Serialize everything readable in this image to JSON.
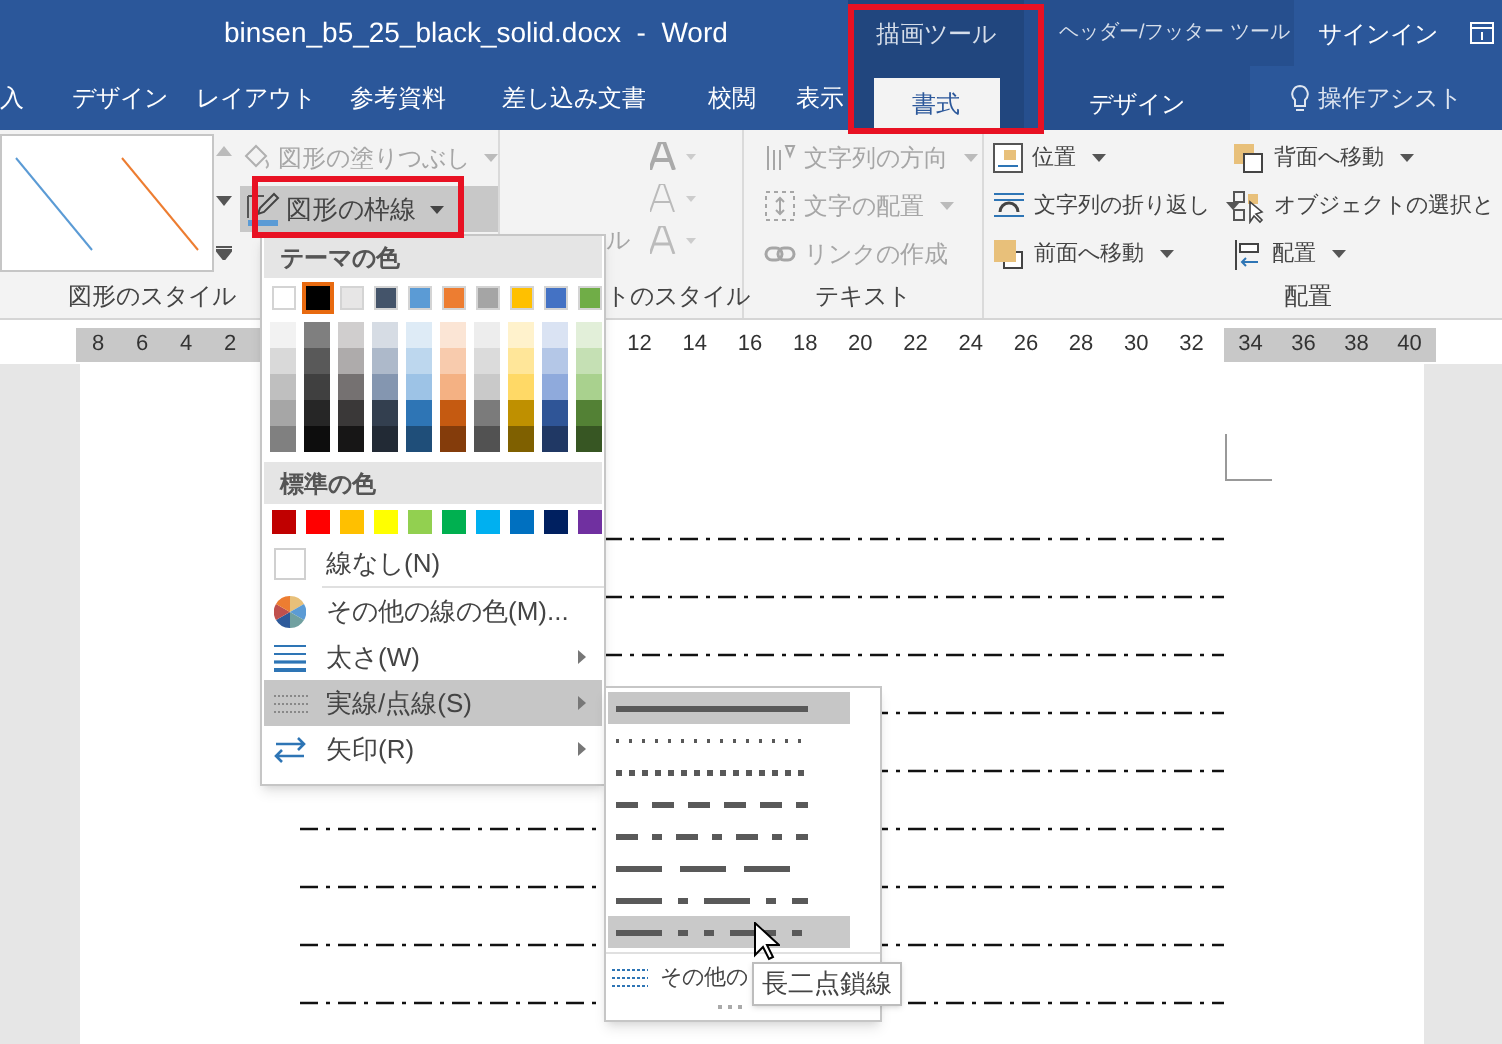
{
  "window": {
    "title": "binsen_b5_25_black_solid.docx  -  Word",
    "context_groups": [
      {
        "label": "描画ツール"
      },
      {
        "label": "ヘッダー/フッター ツール"
      }
    ],
    "sign_in": "サインイン"
  },
  "tabs": [
    {
      "label": "入",
      "selected": false
    },
    {
      "label": "デザイン",
      "selected": false
    },
    {
      "label": "レイアウト",
      "selected": false
    },
    {
      "label": "参考資料",
      "selected": false
    },
    {
      "label": "差し込み文書",
      "selected": false
    },
    {
      "label": "校閲",
      "selected": false
    },
    {
      "label": "表示",
      "selected": false
    }
  ],
  "context_tabs": [
    {
      "label": "書式",
      "selected": true
    },
    {
      "label": "デザイン",
      "selected": false
    }
  ],
  "tell_me": "操作アシスト",
  "shape_styles": {
    "fill_button": {
      "label": "図形の塗りつぶし",
      "disabled": true
    },
    "outline_button": {
      "label": "図形の枠線",
      "pressed": true
    },
    "group_label": "図形のスタイル"
  },
  "wordart_styles": {
    "quick_style_fragment": "ル",
    "group_label": "トのスタイル"
  },
  "text_group": {
    "commands": [
      {
        "kind": "direction",
        "label": "文字列の方向",
        "disabled": true
      },
      {
        "kind": "align",
        "label": "文字の配置",
        "disabled": true
      },
      {
        "kind": "link",
        "label": "リンクの作成",
        "disabled": true
      }
    ],
    "group_label": "テキスト"
  },
  "arrange": {
    "commands": [
      {
        "kind": "position",
        "label": "位置",
        "dropdown": true
      },
      {
        "kind": "wrap",
        "label": "文字列の折り返し",
        "dropdown": true
      },
      {
        "kind": "forward",
        "label": "前面へ移動",
        "dropdown": true
      },
      {
        "kind": "backward",
        "label": "背面へ移動",
        "dropdown": true
      },
      {
        "kind": "selection",
        "label": "オブジェクトの選択と",
        "dropdown": false
      },
      {
        "kind": "align",
        "label": "配置",
        "dropdown": true
      }
    ],
    "group_label": "配置"
  },
  "ruler": {
    "left_margin_numbers": [
      "8",
      "6",
      "4",
      "2"
    ],
    "body_numbers": [
      "12",
      "14",
      "16",
      "18",
      "20",
      "22",
      "24",
      "26",
      "28",
      "30",
      "32"
    ],
    "right_margin_numbers": [
      "34",
      "36",
      "38",
      "40"
    ]
  },
  "outline_menu": {
    "theme_header": "テーマの色",
    "theme_colors": [
      {
        "color": "#ffffff",
        "selected": false
      },
      {
        "color": "#000000",
        "selected": true
      },
      {
        "color": "#e7e6e6",
        "selected": false
      },
      {
        "color": "#44546a",
        "selected": false
      },
      {
        "color": "#5b9bd5",
        "selected": false
      },
      {
        "color": "#ed7d31",
        "selected": false
      },
      {
        "color": "#a5a5a5",
        "selected": false
      },
      {
        "color": "#ffc000",
        "selected": false
      },
      {
        "color": "#4472c4",
        "selected": false
      },
      {
        "color": "#70ad47",
        "selected": false
      }
    ],
    "theme_shades": [
      {
        "shades": [
          {
            "color": "#f2f2f2",
            "selected": false
          },
          {
            "color": "#d9d9d9",
            "selected": false
          },
          {
            "color": "#bfbfbf",
            "selected": false
          },
          {
            "color": "#a6a6a6",
            "selected": false
          },
          {
            "color": "#808080",
            "selected": false
          }
        ]
      },
      {
        "shades": [
          {
            "color": "#7f7f7f",
            "selected": false
          },
          {
            "color": "#595959",
            "selected": false
          },
          {
            "color": "#404040",
            "selected": false
          },
          {
            "color": "#262626",
            "selected": false
          },
          {
            "color": "#0d0d0d",
            "selected": false
          }
        ]
      },
      {
        "shades": [
          {
            "color": "#d0cece",
            "selected": false
          },
          {
            "color": "#aeabab",
            "selected": false
          },
          {
            "color": "#757171",
            "selected": false
          },
          {
            "color": "#3a3838",
            "selected": false
          },
          {
            "color": "#171616",
            "selected": false
          }
        ]
      },
      {
        "shades": [
          {
            "color": "#d6dce4",
            "selected": false
          },
          {
            "color": "#adb9ca",
            "selected": false
          },
          {
            "color": "#8496b0",
            "selected": false
          },
          {
            "color": "#333f4f",
            "selected": false
          },
          {
            "color": "#222a35",
            "selected": false
          }
        ]
      },
      {
        "shades": [
          {
            "color": "#deebf6",
            "selected": false
          },
          {
            "color": "#bdd7ee",
            "selected": false
          },
          {
            "color": "#9dc3e6",
            "selected": false
          },
          {
            "color": "#2e75b5",
            "selected": false
          },
          {
            "color": "#1f4e79",
            "selected": false
          }
        ]
      },
      {
        "shades": [
          {
            "color": "#fbe5d5",
            "selected": false
          },
          {
            "color": "#f8cbad",
            "selected": false
          },
          {
            "color": "#f4b183",
            "selected": false
          },
          {
            "color": "#c55a11",
            "selected": false
          },
          {
            "color": "#843c0b",
            "selected": false
          }
        ]
      },
      {
        "shades": [
          {
            "color": "#ededed",
            "selected": false
          },
          {
            "color": "#dbdbdb",
            "selected": false
          },
          {
            "color": "#c9c9c9",
            "selected": false
          },
          {
            "color": "#7b7b7b",
            "selected": false
          },
          {
            "color": "#525252",
            "selected": false
          }
        ]
      },
      {
        "shades": [
          {
            "color": "#fff2cc",
            "selected": false
          },
          {
            "color": "#ffe699",
            "selected": false
          },
          {
            "color": "#ffd966",
            "selected": false
          },
          {
            "color": "#bf9000",
            "selected": false
          },
          {
            "color": "#7f6000",
            "selected": false
          }
        ]
      },
      {
        "shades": [
          {
            "color": "#dae3f3",
            "selected": false
          },
          {
            "color": "#b4c7e7",
            "selected": false
          },
          {
            "color": "#8faadc",
            "selected": false
          },
          {
            "color": "#2f5597",
            "selected": false
          },
          {
            "color": "#203864",
            "selected": false
          }
        ]
      },
      {
        "shades": [
          {
            "color": "#e2efd9",
            "selected": false
          },
          {
            "color": "#c5e0b4",
            "selected": false
          },
          {
            "color": "#a9d18e",
            "selected": false
          },
          {
            "color": "#538135",
            "selected": false
          },
          {
            "color": "#375623",
            "selected": false
          }
        ]
      }
    ],
    "standard_header": "標準の色",
    "standard_colors": [
      {
        "color": "#c00000",
        "selected": false
      },
      {
        "color": "#ff0000",
        "selected": false
      },
      {
        "color": "#ffc000",
        "selected": false
      },
      {
        "color": "#ffff00",
        "selected": false
      },
      {
        "color": "#92d050",
        "selected": false
      },
      {
        "color": "#00b050",
        "selected": false
      },
      {
        "color": "#00b0f0",
        "selected": false
      },
      {
        "color": "#0070c0",
        "selected": false
      },
      {
        "color": "#002060",
        "selected": false
      },
      {
        "color": "#7030a0",
        "selected": false
      }
    ],
    "items": [
      {
        "kind": "no-line",
        "label": "線なし(N)",
        "submenu": false,
        "selected": false
      },
      {
        "kind": "more-colors",
        "label": "その他の線の色(M)...",
        "submenu": false,
        "selected": false
      },
      {
        "kind": "weight",
        "label": "太さ(W)",
        "submenu": true,
        "selected": false
      },
      {
        "kind": "dashes",
        "label": "実線/点線(S)",
        "submenu": true,
        "selected": true
      },
      {
        "kind": "arrows",
        "label": "矢印(R)",
        "submenu": true,
        "selected": false
      }
    ]
  },
  "dash_menu": {
    "styles": [
      {
        "kind": "solid",
        "selected": true,
        "hovered": false
      },
      {
        "kind": "round-dot",
        "selected": false,
        "hovered": false
      },
      {
        "kind": "square-dot",
        "selected": false,
        "hovered": false
      },
      {
        "kind": "dash",
        "selected": false,
        "hovered": false
      },
      {
        "kind": "dash-dot",
        "selected": false,
        "hovered": false
      },
      {
        "kind": "long-dash",
        "selected": false,
        "hovered": false
      },
      {
        "kind": "long-dash-dot",
        "selected": false,
        "hovered": false
      },
      {
        "kind": "long-dash-dot-dot",
        "selected": false,
        "hovered": true
      }
    ],
    "more_label": "その他の",
    "tooltip": "長二点鎖線"
  }
}
